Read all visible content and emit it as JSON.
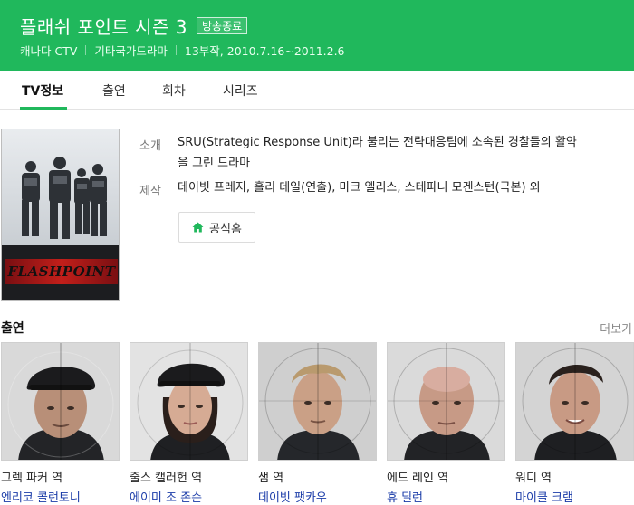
{
  "program": {
    "title": "플래쉬 포인트 시즌 3",
    "status_badge": "방송종료",
    "channel": "캐나다 CTV",
    "genre": "기타국가드라마",
    "episodes_dates": "13부작, 2010.7.16~2011.2.6"
  },
  "tabs": [
    {
      "label": "TV정보",
      "active": true
    },
    {
      "label": "출연",
      "active": false
    },
    {
      "label": "회차",
      "active": false
    },
    {
      "label": "시리즈",
      "active": false
    }
  ],
  "poster": {
    "logo_text": "FLASHPOINT"
  },
  "info": {
    "intro_label": "소개",
    "intro_line1": "SRU(Strategic Response Unit)라 불리는 전략대응팀에 소속된 경찰들의 활약",
    "intro_line2": "을 그린 드라마",
    "production_label": "제작",
    "production_text": "데이빗 프레지, 홀리 데일(연출), 마크 엘리스, 스테파니 모겐스턴(극본) 외"
  },
  "official_home": {
    "label": "공식홈"
  },
  "cast_section": {
    "title": "출연",
    "more_label": "더보기",
    "cast": [
      {
        "role": "그렉 파커 역",
        "actor": "엔리코 콜런토니"
      },
      {
        "role": "줄스 캘러헌 역",
        "actor": "에이미 조 존슨"
      },
      {
        "role": "샘 역",
        "actor": "데이빗 팻카우"
      },
      {
        "role": "에드 레인 역",
        "actor": "휴 딜런"
      },
      {
        "role": "워디 역",
        "actor": "마이클 크램"
      }
    ]
  },
  "colors": {
    "brand_green": "#20b85c",
    "link_blue": "#1a3ba8"
  }
}
